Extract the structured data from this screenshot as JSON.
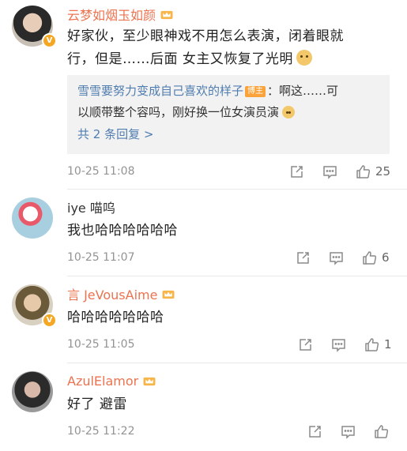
{
  "comments": [
    {
      "username": "云梦如烟玉如颜",
      "verified": true,
      "text_line1": "好家伙，至少眼神戏不用怎么表演，闭着眼就",
      "text_line2": "行，但是……后面 女主又恢复了光明",
      "emoji_icon": "doge-emoji",
      "reply": {
        "name": "雪雪要努力变成自己喜欢的样子",
        "tag": "博主",
        "line1_rest": "：啊这……可",
        "line2": "以顺带整个容吗，刚好换一位女演员演",
        "more": "共 2 条回复 >"
      },
      "time": "10-25 11:08",
      "likes": "25"
    },
    {
      "username": "iye 喵呜",
      "text": "我也哈哈哈哈哈哈",
      "time": "10-25 11:07",
      "likes": "6"
    },
    {
      "username": "言 JeVousAime",
      "verified": true,
      "text": "哈哈哈哈哈哈哈",
      "time": "10-25 11:05",
      "likes": "1"
    },
    {
      "username": "AzulElamor",
      "text": "好了 避雷",
      "time": "10-25 11:22",
      "likes": ""
    }
  ],
  "icons": {
    "share": "share-icon",
    "comment": "comment-icon",
    "like": "like-icon",
    "member_badge": "crown-badge-icon"
  },
  "colors": {
    "username": "#eb7350",
    "link": "#507daf",
    "meta": "#939393",
    "reply_bg": "#f2f2f2"
  }
}
